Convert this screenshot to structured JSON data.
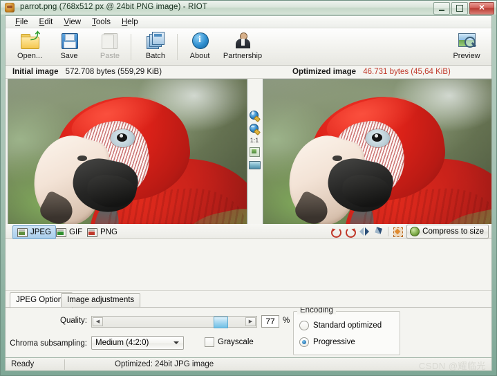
{
  "window": {
    "title": "parrot.png (768x512 px @ 24bit PNG image) - RIOT",
    "app_icon": "riot-app-icon",
    "minimize": "–",
    "maximize": "□",
    "close": "✕"
  },
  "menu": [
    {
      "label": "File",
      "accel": "F"
    },
    {
      "label": "Edit",
      "accel": "E"
    },
    {
      "label": "View",
      "accel": "V"
    },
    {
      "label": "Tools",
      "accel": "T"
    },
    {
      "label": "Help",
      "accel": "H"
    }
  ],
  "toolbar": {
    "open_label": "Open...",
    "save_label": "Save",
    "paste_label": "Paste",
    "batch_label": "Batch",
    "about_label": "About",
    "partnership_label": "Partnership",
    "preview_label": "Preview"
  },
  "info": {
    "initial_label": "Initial image",
    "initial_value": "572.708 bytes (559,29 KiB)",
    "optimized_label": "Optimized image",
    "optimized_value": "46.731 bytes (45,64 KiB)",
    "optimized_color": "#c0392b"
  },
  "zoom_tools": {
    "zoom_in": "+",
    "zoom_out": "–",
    "actual_size": "1:1",
    "fit_label": "fit-to-window",
    "screen_label": "fit-to-screen"
  },
  "format_tabs": [
    {
      "label": "JPEG",
      "active": true
    },
    {
      "label": "GIF",
      "active": false
    },
    {
      "label": "PNG",
      "active": false
    }
  ],
  "image_tools": {
    "rotate_left": "rotate-left",
    "rotate_right": "rotate-right",
    "flip_horizontal": "flip-horizontal",
    "flip_vertical": "flip-vertical",
    "resize": "resize",
    "compress_label": "Compress to size"
  },
  "jpeg_options": {
    "quality_label": "Quality:",
    "quality_value": "77",
    "quality_percent": "%",
    "slider_left_arrow": "◀",
    "slider_right_arrow": "▶",
    "chroma_label": "Chroma subsampling:",
    "chroma_value": "Medium (4:2:0)",
    "grayscale_label": "Grayscale",
    "grayscale_checked": false,
    "encoding_title": "Encoding",
    "encoding_options": [
      {
        "label": "Standard optimized",
        "selected": false
      },
      {
        "label": "Progressive",
        "selected": true
      }
    ]
  },
  "bottom_tabs": [
    {
      "label": "JPEG Options",
      "active": true
    },
    {
      "label": "Image adjustments",
      "active": false
    }
  ],
  "statusbar": {
    "ready": "Ready",
    "optimized": "Optimized: 24bit JPG image",
    "watermark": "CSDN @耀临光"
  }
}
